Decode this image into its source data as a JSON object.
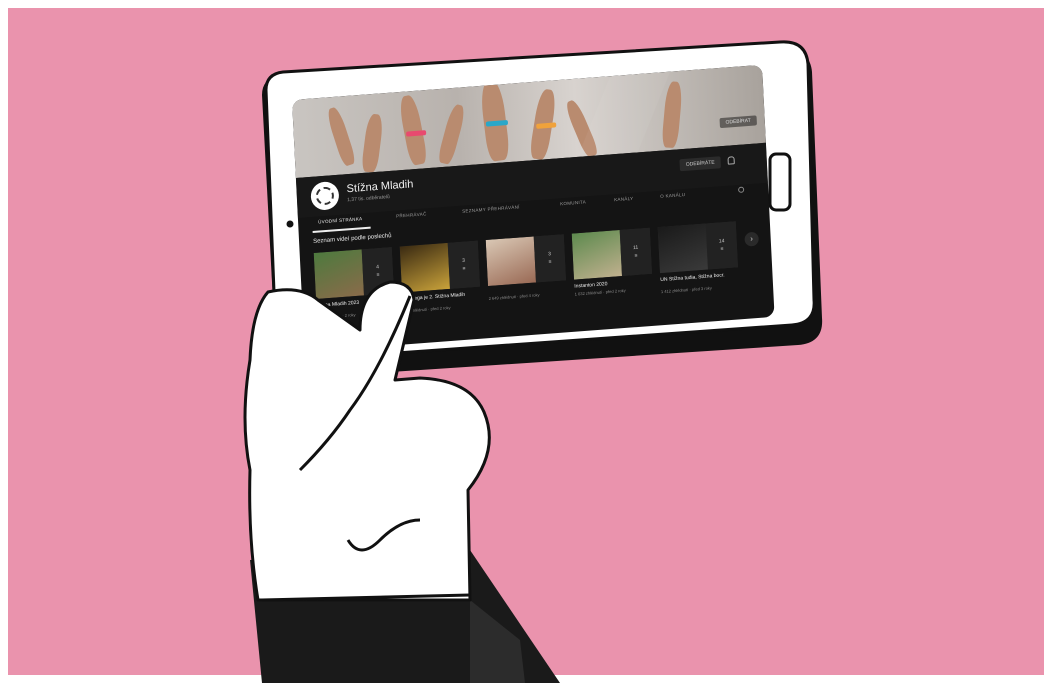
{
  "channel": {
    "name": "Stížna Mladih",
    "subscribers": "1,37 tis. odběratelů",
    "subscribe_label": "ODEBÍRÁTE",
    "banner_subscribe": "ODEBÍRAT"
  },
  "tabs": [
    {
      "label": "ÚVODNÍ STRÁNKA",
      "active": true
    },
    {
      "label": "PŘEHRÁVAČ"
    },
    {
      "label": "SEZNAMY PŘEHRÁVÁNÍ"
    },
    {
      "label": "KOMUNITA"
    },
    {
      "label": "KANÁLY"
    },
    {
      "label": "O KANÁLU"
    }
  ],
  "section_title": "Seznam videí podle poslechů",
  "videos": [
    {
      "title": "Stížna Mladih 2023",
      "meta": "Stížna Mladih · 2 roky",
      "count": "4"
    },
    {
      "title": "Od njega je 2. Stížna Mladih",
      "meta": "384 zhlédnutí · před 2 roky",
      "count": "3"
    },
    {
      "title": "",
      "meta": "2 649 zhlédnutí · před 4 roky",
      "count": "3"
    },
    {
      "title": "Instanton 2020",
      "meta": "1 032 zhlédnutí · před 2 roky",
      "count": "11"
    },
    {
      "title": "UN Stížna tudia, Stížna bocr.",
      "meta": "1 412 zhlédnutí · před 3 roky",
      "count": "14"
    }
  ],
  "colors": {
    "background": "#ea93ad",
    "screen": "#141414",
    "device": "#ffffff",
    "outline": "#111111"
  }
}
